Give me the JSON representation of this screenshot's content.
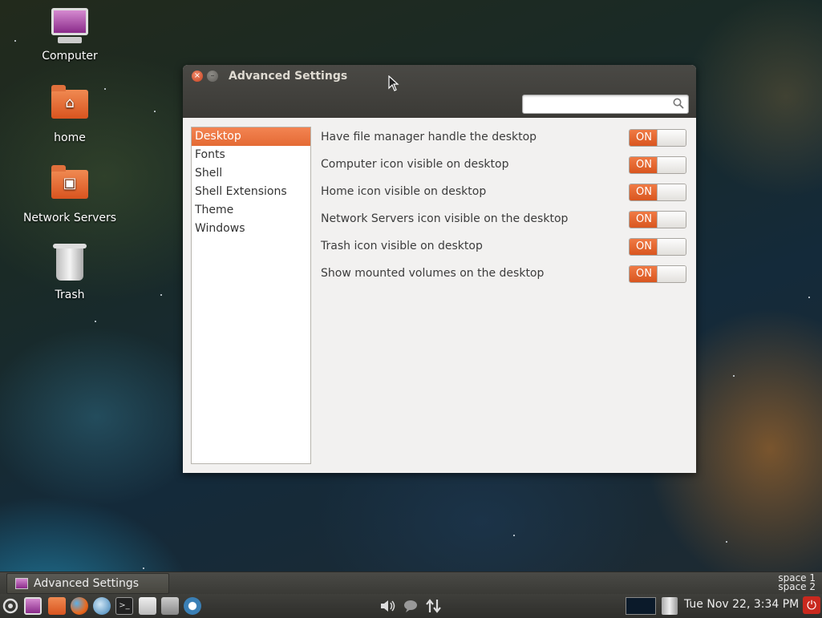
{
  "desktop": {
    "icons": [
      {
        "label": "Computer"
      },
      {
        "label": "home"
      },
      {
        "label": "Network Servers"
      },
      {
        "label": "Trash"
      }
    ]
  },
  "window": {
    "title": "Advanced Settings",
    "search": {
      "value": "",
      "placeholder": ""
    },
    "sidebar": {
      "items": [
        {
          "label": "Desktop",
          "active": true
        },
        {
          "label": "Fonts"
        },
        {
          "label": "Shell"
        },
        {
          "label": "Shell Extensions"
        },
        {
          "label": "Theme"
        },
        {
          "label": "Windows"
        }
      ]
    },
    "settings": [
      {
        "label": "Have file manager handle the desktop",
        "state": "ON"
      },
      {
        "label": "Computer icon visible on desktop",
        "state": "ON"
      },
      {
        "label": "Home icon visible on desktop",
        "state": "ON"
      },
      {
        "label": "Network Servers icon visible on the desktop",
        "state": "ON"
      },
      {
        "label": "Trash icon visible on desktop",
        "state": "ON"
      },
      {
        "label": "Show mounted volumes on the desktop",
        "state": "ON"
      }
    ]
  },
  "taskbar": {
    "task_label": "Advanced Settings",
    "space1": "space 1",
    "space2": "space 2",
    "clock": "Tue Nov 22,  3:34 PM"
  },
  "colors": {
    "accent": "#e46a34",
    "close": "#c7401f",
    "power": "#c9291e"
  }
}
